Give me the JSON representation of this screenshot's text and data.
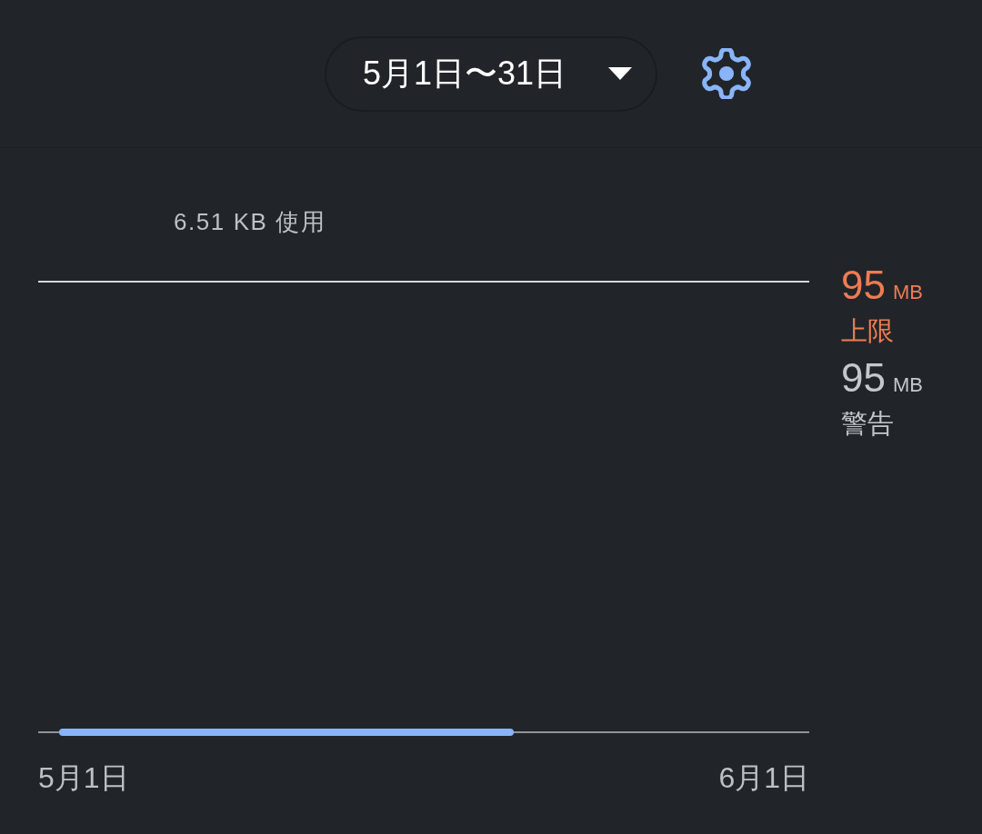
{
  "date_range": {
    "label": "5月1日〜31日"
  },
  "usage": {
    "text": "6.51 KB 使用"
  },
  "thresholds": [
    {
      "kind": "limit",
      "value": "95",
      "unit": "MB",
      "label": "上限"
    },
    {
      "kind": "warning",
      "value": "95",
      "unit": "MB",
      "label": "警告"
    }
  ],
  "axis": {
    "start": "5月1日",
    "end": "6月1日"
  }
}
